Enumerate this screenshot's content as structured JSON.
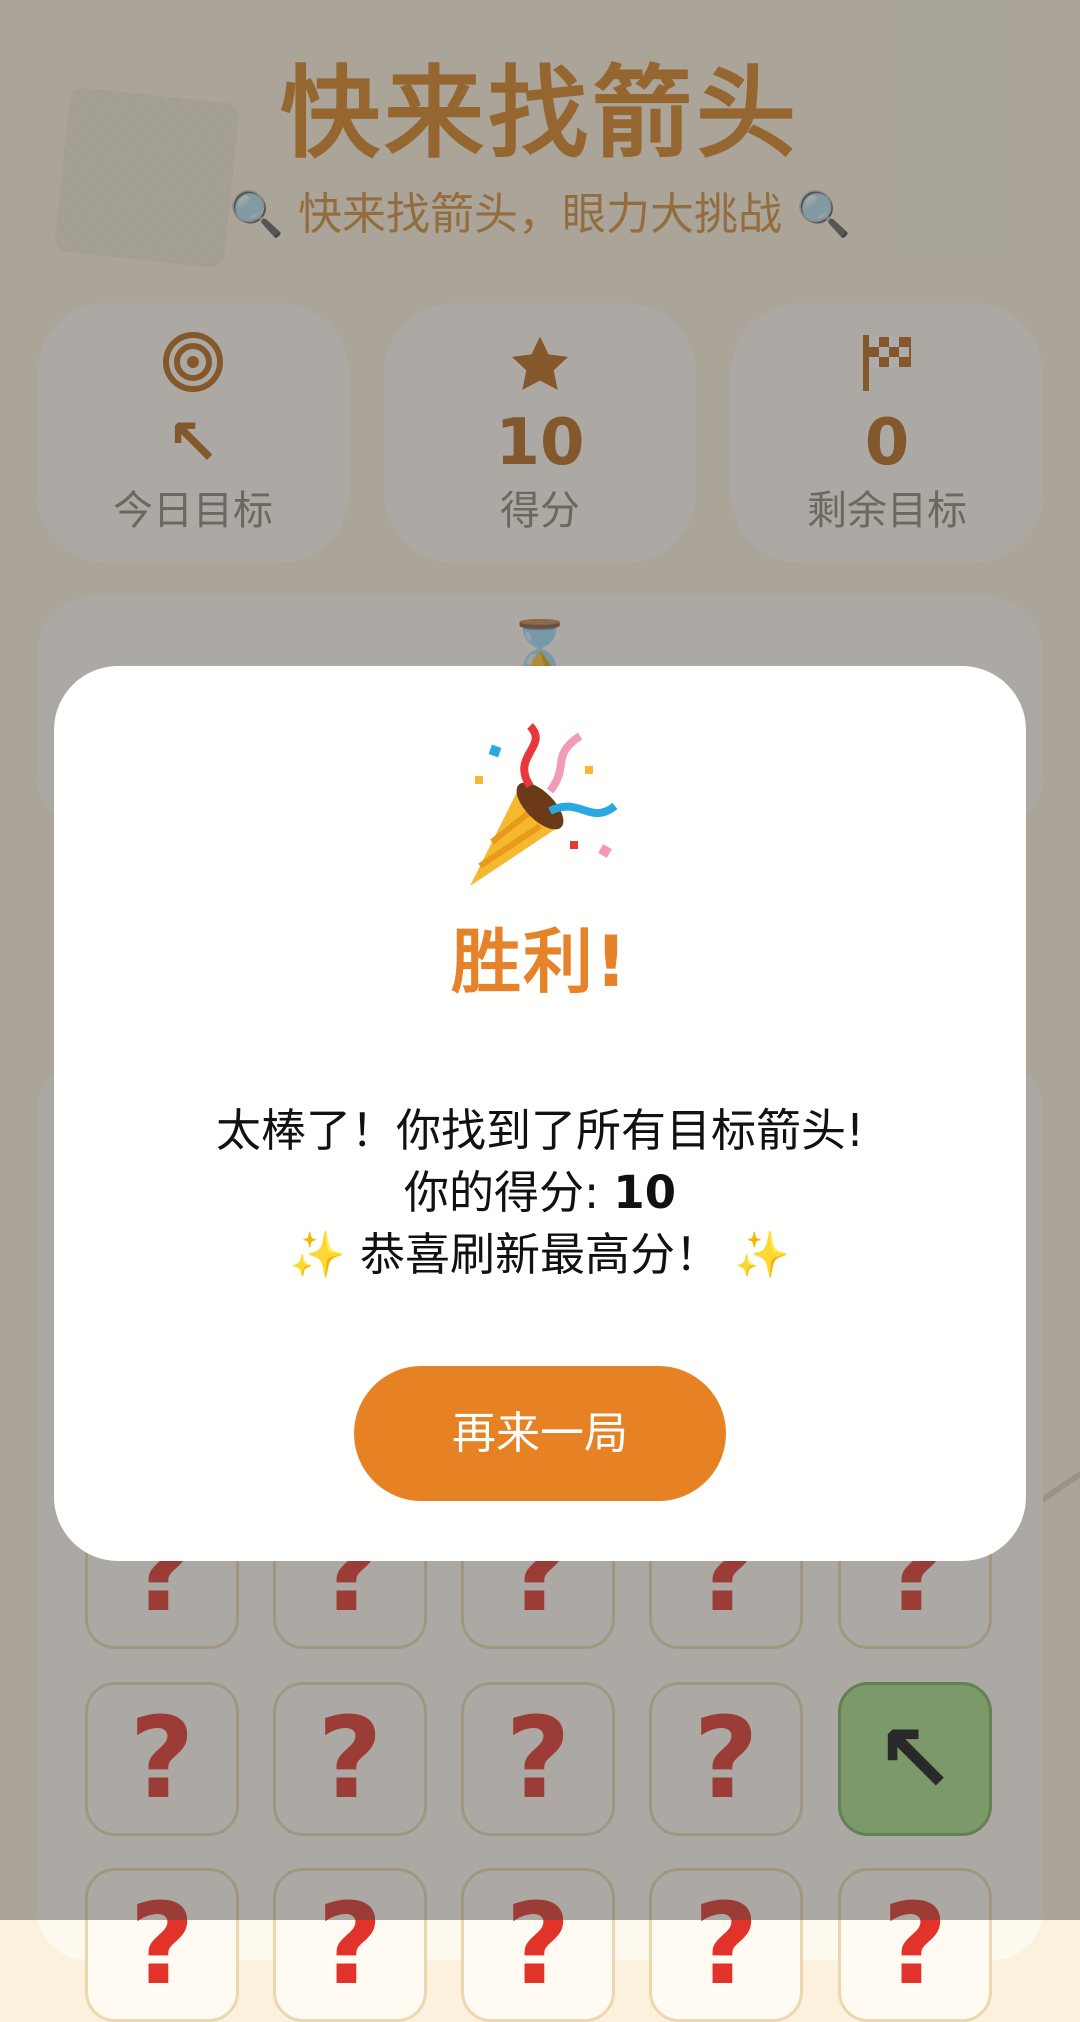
{
  "header": {
    "title": "快来找箭头",
    "subtitle": "快来找箭头，眼力大挑战",
    "subtitle_icon": "magnifier-icon"
  },
  "stats": {
    "target": {
      "icon": "target-icon",
      "value": "↖",
      "label": "今日目标"
    },
    "score": {
      "icon": "star-icon",
      "value": "10",
      "label": "得分"
    },
    "remaining": {
      "icon": "checkered-flag-icon",
      "value": "0",
      "label": "剩余目标"
    }
  },
  "timer": {
    "icon": "hourglass-icon"
  },
  "board": {
    "hidden_symbol": "?",
    "found_symbol": "↖",
    "rows_visible": [
      [
        "?",
        "?",
        "?",
        "?",
        "?"
      ],
      [
        "?",
        "?",
        "?",
        "?",
        "↖"
      ],
      [
        "?",
        "?",
        "?",
        "?",
        "?"
      ]
    ]
  },
  "modal": {
    "icon": "party-popper-icon",
    "title": "胜利!",
    "line1": "太棒了！你找到了所有目标箭头!",
    "line2_prefix": "你的得分: ",
    "line2_score": "10",
    "line3": "恭喜刷新最高分！",
    "sparkle_icon": "sparkles-icon",
    "button": "再来一局"
  },
  "colors": {
    "accent": "#e68124",
    "title": "#d8801f",
    "found_cell": "#a6dc86",
    "question_mark": "#e2332b"
  }
}
